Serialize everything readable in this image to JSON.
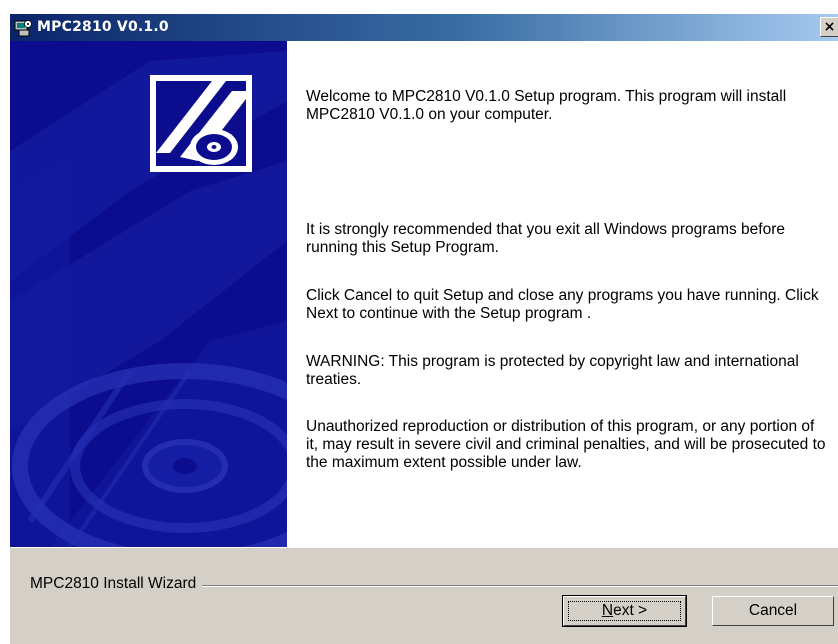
{
  "window": {
    "title": "MPC2810 V0.1.0",
    "close_label": "×"
  },
  "content": {
    "paragraphs": [
      "Welcome to MPC2810 V0.1.0 Setup program. This program will install MPC2810 V0.1.0 on your computer.",
      "It is strongly recommended that you exit all Windows programs before running this Setup Program.",
      "Click Cancel to quit Setup and close any programs you have running.  Click Next to continue with the Setup program .",
      "WARNING: This program is protected by copyright law and international treaties.",
      "Unauthorized reproduction or distribution of this program, or any portion of it, may result in severe civil and criminal penalties, and will be prosecuted to the maximum extent possible under law."
    ]
  },
  "footer": {
    "group_label": "MPC2810 Install Wizard",
    "next_mnemonic": "N",
    "next_rest": "ext >",
    "cancel_label": "Cancel"
  },
  "colors": {
    "banner_blue": "#0b0c8e",
    "titlebar_start": "#0a246a",
    "titlebar_end": "#a6caf0",
    "dialog_gray": "#d4d0c8"
  },
  "icons": [
    "setup-app-icon",
    "close-icon",
    "installer-cd-logo-icon",
    "cd-disc-watermark-icon"
  ]
}
